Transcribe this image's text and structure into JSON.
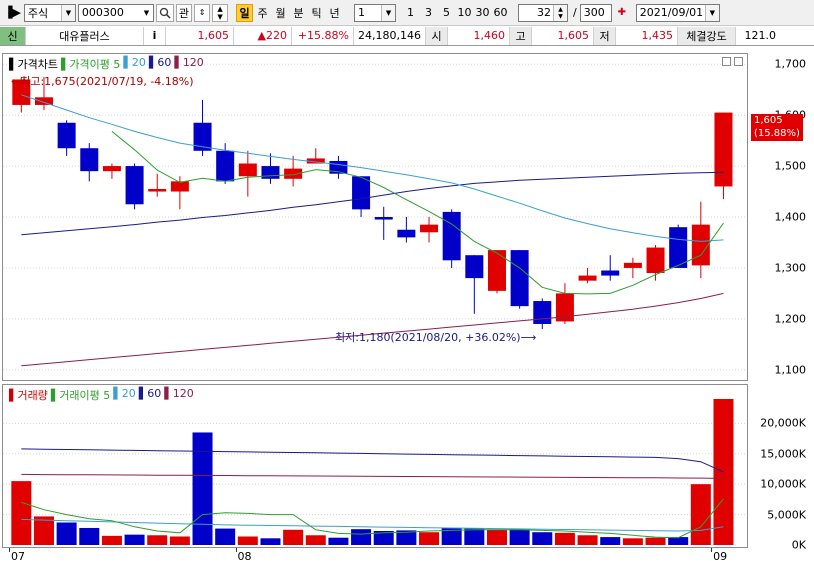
{
  "toolbar": {
    "market": "주식",
    "code": "000300",
    "btn_gwan": "관",
    "periods": [
      "일",
      "주",
      "월",
      "분",
      "틱",
      "년"
    ],
    "active_period": "일",
    "interval_value": "1",
    "quick_intervals": [
      "1",
      "3",
      "5",
      "10",
      "30",
      "60"
    ],
    "count": "32",
    "total": "300",
    "date": "2021/09/01"
  },
  "infobar": {
    "tag": "신",
    "name": "대유플러스",
    "info_icon": "i",
    "price": "1,605",
    "change": "▲220",
    "change_pct": "+15.88%",
    "volume": "24,180,146",
    "open_label": "시",
    "open": "1,460",
    "high_label": "고",
    "high": "1,605",
    "low_label": "저",
    "low": "1,435",
    "strength_label": "체결강도",
    "strength": "121.0"
  },
  "price_panel": {
    "legend": [
      {
        "text": "가격차트",
        "color": "#000000"
      },
      {
        "text": "가격이평 5",
        "color": "#2f9e2f"
      },
      {
        "text": "20",
        "color": "#3aa0d0"
      },
      {
        "text": "60",
        "color": "#1a1a8c"
      },
      {
        "text": "120",
        "color": "#8a1f4a"
      }
    ],
    "high_annotation": "←최고:1,675(2021/07/19, -4.18%)",
    "low_annotation": "최저:1,180(2021/08/20, +36.02%)⟶",
    "current_price_tag": "1,605",
    "current_pct_tag": "(15.88%)",
    "y_ticks": [
      "1,700",
      "1,600",
      "1,500",
      "1,400",
      "1,300",
      "1,200",
      "1,100"
    ]
  },
  "volume_panel": {
    "legend": [
      {
        "text": "거래량",
        "color": "#cc0000"
      },
      {
        "text": "거래이평 5",
        "color": "#2f9e2f"
      },
      {
        "text": "20",
        "color": "#3aa0d0"
      },
      {
        "text": "60",
        "color": "#1a1a8c"
      },
      {
        "text": "120",
        "color": "#8a1f4a"
      }
    ],
    "y_ticks": [
      "20,000K",
      "15,000K",
      "10,000K",
      "5,000K",
      "0K"
    ]
  },
  "x_axis": {
    "labels": [
      "07",
      "08",
      "09"
    ]
  },
  "colors": {
    "up": "#e00000",
    "down": "#0000c8",
    "ma5": "#2f9e2f",
    "ma20": "#3aa0d0",
    "ma60": "#1a1a8c",
    "ma120": "#8a1f4a"
  },
  "chart_data": {
    "type": "candlestick",
    "ylim": [
      1080,
      1720
    ],
    "volume_ylim": [
      0,
      24000
    ],
    "candles": [
      {
        "o": 1620,
        "h": 1675,
        "l": 1605,
        "c": 1670
      },
      {
        "o": 1620,
        "h": 1675,
        "l": 1610,
        "c": 1635
      },
      {
        "o": 1585,
        "h": 1590,
        "l": 1520,
        "c": 1535
      },
      {
        "o": 1535,
        "h": 1545,
        "l": 1470,
        "c": 1490
      },
      {
        "o": 1490,
        "h": 1505,
        "l": 1475,
        "c": 1500
      },
      {
        "o": 1500,
        "h": 1505,
        "l": 1415,
        "c": 1425
      },
      {
        "o": 1450,
        "h": 1485,
        "l": 1440,
        "c": 1455
      },
      {
        "o": 1450,
        "h": 1480,
        "l": 1415,
        "c": 1470
      },
      {
        "o": 1585,
        "h": 1630,
        "l": 1520,
        "c": 1530
      },
      {
        "o": 1530,
        "h": 1545,
        "l": 1465,
        "c": 1470
      },
      {
        "o": 1480,
        "h": 1530,
        "l": 1440,
        "c": 1505
      },
      {
        "o": 1500,
        "h": 1525,
        "l": 1465,
        "c": 1475
      },
      {
        "o": 1475,
        "h": 1520,
        "l": 1460,
        "c": 1495
      },
      {
        "o": 1505,
        "h": 1535,
        "l": 1505,
        "c": 1515
      },
      {
        "o": 1510,
        "h": 1520,
        "l": 1475,
        "c": 1485
      },
      {
        "o": 1480,
        "h": 1480,
        "l": 1400,
        "c": 1415
      },
      {
        "o": 1400,
        "h": 1420,
        "l": 1355,
        "c": 1395
      },
      {
        "o": 1375,
        "h": 1400,
        "l": 1350,
        "c": 1360
      },
      {
        "o": 1370,
        "h": 1400,
        "l": 1350,
        "c": 1385
      },
      {
        "o": 1410,
        "h": 1415,
        "l": 1300,
        "c": 1315
      },
      {
        "o": 1325,
        "h": 1325,
        "l": 1210,
        "c": 1280
      },
      {
        "o": 1255,
        "h": 1330,
        "l": 1250,
        "c": 1335
      },
      {
        "o": 1335,
        "h": 1335,
        "l": 1220,
        "c": 1225
      },
      {
        "o": 1235,
        "h": 1240,
        "l": 1180,
        "c": 1190
      },
      {
        "o": 1195,
        "h": 1270,
        "l": 1190,
        "c": 1250
      },
      {
        "o": 1275,
        "h": 1300,
        "l": 1270,
        "c": 1285
      },
      {
        "o": 1295,
        "h": 1325,
        "l": 1275,
        "c": 1285
      },
      {
        "o": 1300,
        "h": 1320,
        "l": 1280,
        "c": 1310
      },
      {
        "o": 1290,
        "h": 1345,
        "l": 1275,
        "c": 1340
      },
      {
        "o": 1380,
        "h": 1385,
        "l": 1305,
        "c": 1300
      },
      {
        "o": 1305,
        "h": 1430,
        "l": 1280,
        "c": 1385
      },
      {
        "o": 1460,
        "h": 1605,
        "l": 1435,
        "c": 1605
      }
    ],
    "ma5": [
      null,
      null,
      null,
      null,
      1568,
      1532,
      1492,
      1468,
      1476,
      1470,
      1478,
      1481,
      1483,
      1493,
      1489,
      1478,
      1458,
      1434,
      1411,
      1386,
      1352,
      1329,
      1300,
      1262,
      1250,
      1249,
      1250,
      1266,
      1287,
      1305,
      1325,
      1388
    ],
    "ma20": [
      1640,
      1625,
      1610,
      1595,
      1582,
      1568,
      1556,
      1545,
      1538,
      1531,
      1525,
      1519,
      1513,
      1508,
      1503,
      1497,
      1490,
      1483,
      1475,
      1467,
      1455,
      1441,
      1427,
      1412,
      1398,
      1387,
      1377,
      1369,
      1362,
      1356,
      1352,
      1355
    ],
    "ma60": [
      1365,
      1369,
      1373,
      1377,
      1381,
      1385,
      1390,
      1394,
      1399,
      1403,
      1408,
      1413,
      1419,
      1424,
      1430,
      1436,
      1443,
      1450,
      1456,
      1461,
      1466,
      1469,
      1472,
      1474,
      1476,
      1478,
      1480,
      1482,
      1484,
      1486,
      1487,
      1488
    ],
    "ma120": [
      1108,
      1112,
      1116,
      1120,
      1124,
      1128,
      1132,
      1136,
      1140,
      1144,
      1148,
      1152,
      1156,
      1160,
      1164,
      1168,
      1172,
      1176,
      1180,
      1184,
      1188,
      1192,
      1196,
      1200,
      1204,
      1209,
      1214,
      1219,
      1225,
      1232,
      1240,
      1250
    ],
    "volume": [
      10500,
      4700,
      3700,
      2800,
      1500,
      1700,
      1600,
      1400,
      18500,
      2700,
      1400,
      1100,
      2500,
      1600,
      1200,
      2600,
      2300,
      2400,
      2100,
      2800,
      2700,
      2500,
      2600,
      2100,
      2000,
      1600,
      1300,
      1100,
      1200,
      1300,
      10000,
      24000
    ],
    "vol_ma5": [
      7000,
      5800,
      5000,
      4300,
      4000,
      3000,
      2300,
      2000,
      5000,
      5300,
      5200,
      5000,
      5000,
      2500,
      1900,
      1800,
      2000,
      2100,
      2300,
      2400,
      2500,
      2500,
      2500,
      2400,
      2300,
      2100,
      1900,
      1600,
      1300,
      1200,
      3000,
      7600
    ],
    "vol_ma20": [
      4200,
      4100,
      4000,
      3900,
      3800,
      3700,
      3600,
      3500,
      3400,
      3300,
      3250,
      3200,
      3150,
      3100,
      3050,
      3000,
      2950,
      2900,
      2850,
      2800,
      2750,
      2700,
      2650,
      2600,
      2550,
      2500,
      2450,
      2400,
      2350,
      2300,
      2400,
      3000
    ],
    "vol_ma60": [
      15800,
      15750,
      15700,
      15650,
      15600,
      15550,
      15500,
      15450,
      15400,
      15350,
      15300,
      15250,
      15200,
      15150,
      15100,
      15050,
      15000,
      14950,
      14900,
      14850,
      14800,
      14750,
      14700,
      14650,
      14600,
      14550,
      14500,
      14450,
      14400,
      14200,
      13700,
      12000
    ],
    "vol_ma120": [
      11600,
      11580,
      11560,
      11540,
      11520,
      11500,
      11480,
      11460,
      11440,
      11420,
      11400,
      11380,
      11360,
      11340,
      11320,
      11300,
      11280,
      11260,
      11240,
      11220,
      11200,
      11180,
      11160,
      11140,
      11120,
      11100,
      11080,
      11060,
      11040,
      11020,
      11000,
      10950
    ]
  }
}
